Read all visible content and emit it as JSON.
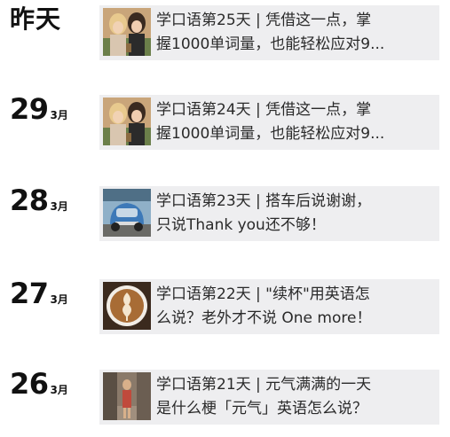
{
  "entries": [
    {
      "date_big": "昨天",
      "date_small": "",
      "line1": "学口语第25天 | 凭借这一点，掌",
      "line2": "握1000单词量，也能轻松应对9...",
      "thumb_icon": "two-women-photo"
    },
    {
      "date_big": "29",
      "date_small": "3月",
      "line1": "学口语第24天 | 凭借这一点，掌",
      "line2": "握1000单词量，也能轻松应对9...",
      "thumb_icon": "two-women-photo"
    },
    {
      "date_big": "28",
      "date_small": "3月",
      "line1": "学口语第23天 | 搭车后说谢谢，",
      "line2": "只说Thank you还不够！",
      "thumb_icon": "blue-car-photo"
    },
    {
      "date_big": "27",
      "date_small": "3月",
      "line1": "学口语第22天 | \"续杯\"用英语怎",
      "line2": "么说？老外才不说 One more！",
      "thumb_icon": "latte-art-photo"
    },
    {
      "date_big": "26",
      "date_small": "3月",
      "line1": "学口语第21天 | 元气满满的一天",
      "line2": "是什么梗「元气」英语怎么说？",
      "thumb_icon": "woman-street-photo"
    }
  ]
}
